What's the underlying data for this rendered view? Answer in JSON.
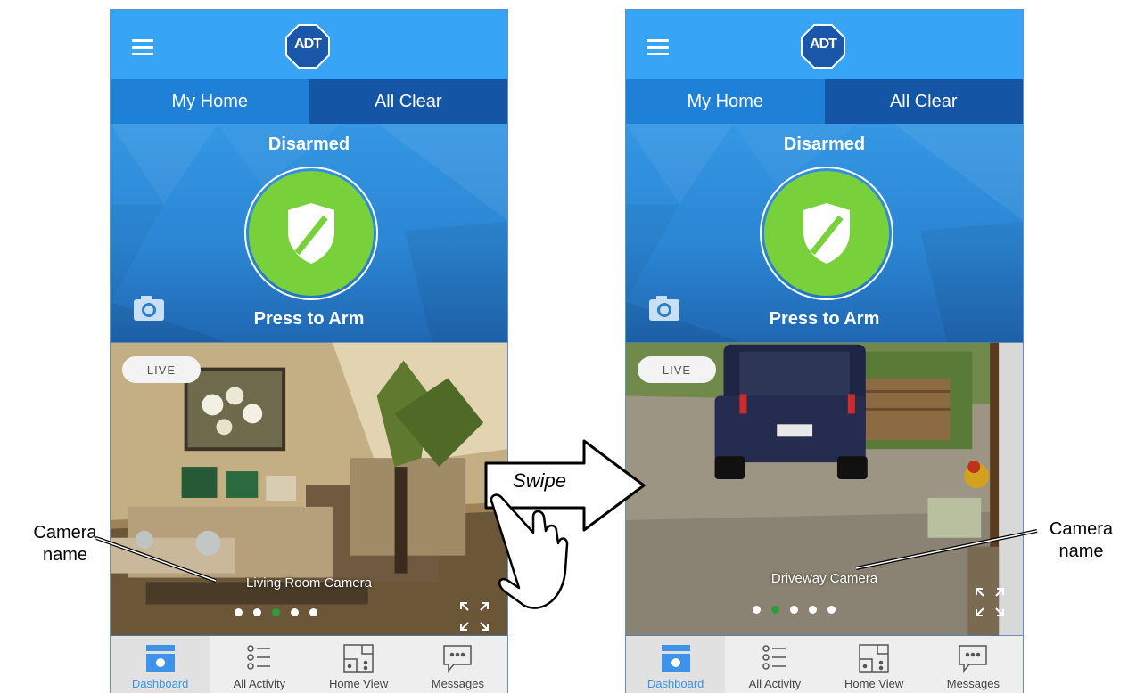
{
  "phones": [
    {
      "header": {
        "logo_text": "ADT"
      },
      "tabs": {
        "home_label": "My Home",
        "status_label": "All Clear"
      },
      "security": {
        "state_label": "Disarmed",
        "action_label": "Press to Arm"
      },
      "camera_feed": {
        "live_label": "LIVE",
        "camera_name": "Living Room Camera",
        "page_count": 5,
        "active_page_index": 2
      },
      "bottom_nav": [
        {
          "label": "Dashboard",
          "icon": "dashboard-icon",
          "active": true
        },
        {
          "label": "All Activity",
          "icon": "activity-list-icon",
          "active": false
        },
        {
          "label": "Home View",
          "icon": "floorplan-icon",
          "active": false
        },
        {
          "label": "Messages",
          "icon": "message-bubble-icon",
          "active": false
        }
      ]
    },
    {
      "header": {
        "logo_text": "ADT"
      },
      "tabs": {
        "home_label": "My Home",
        "status_label": "All Clear"
      },
      "security": {
        "state_label": "Disarmed",
        "action_label": "Press to Arm"
      },
      "camera_feed": {
        "live_label": "LIVE",
        "camera_name": "Driveway Camera",
        "page_count": 5,
        "active_page_index": 1
      },
      "bottom_nav": [
        {
          "label": "Dashboard",
          "icon": "dashboard-icon",
          "active": true
        },
        {
          "label": "All Activity",
          "icon": "activity-list-icon",
          "active": false
        },
        {
          "label": "Home View",
          "icon": "floorplan-icon",
          "active": false
        },
        {
          "label": "Messages",
          "icon": "message-bubble-icon",
          "active": false
        }
      ]
    }
  ],
  "annotations": {
    "swipe_label": "Swipe",
    "callout_left": [
      "Camera",
      "name"
    ],
    "callout_right": [
      "Camera",
      "name"
    ]
  },
  "colors": {
    "header_blue": "#38a4f5",
    "tab_home": "#1f80d8",
    "tab_status": "#1555a6",
    "arm_green": "#78d13a",
    "active_dot_green": "#2f9b3a",
    "nav_active_text": "#3e93e9"
  }
}
